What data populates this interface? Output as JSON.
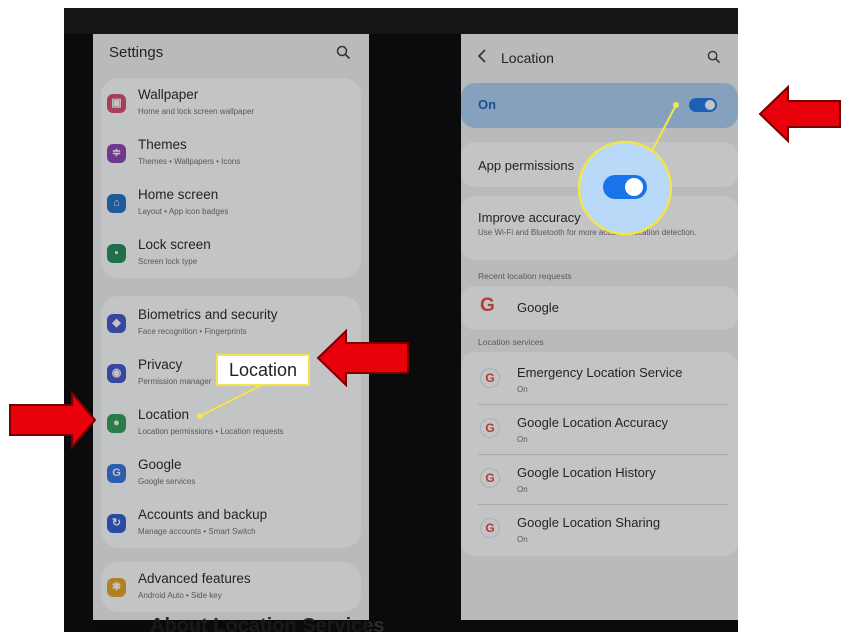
{
  "left_panel": {
    "title": "Settings",
    "items": [
      {
        "title": "Wallpaper",
        "subtitle": "Home and lock screen wallpaper",
        "icon": "wallpaper-icon",
        "color": "#d9466e"
      },
      {
        "title": "Themes",
        "subtitle": "Themes  •  Wallpapers  •  Icons",
        "icon": "themes-icon",
        "color": "#8a3eb0"
      },
      {
        "title": "Home screen",
        "subtitle": "Layout  •  App icon badges",
        "icon": "home-icon",
        "color": "#1a6fc2"
      },
      {
        "title": "Lock screen",
        "subtitle": "Screen lock type",
        "icon": "lock-icon",
        "color": "#1e8a55"
      },
      {
        "title": "Biometrics and security",
        "subtitle": "Face recognition  •  Fingerprints",
        "icon": "shield-icon",
        "color": "#3f53c9"
      },
      {
        "title": "Privacy",
        "subtitle": "Permission manager",
        "icon": "privacy-icon",
        "color": "#3f53c9"
      },
      {
        "title": "Location",
        "subtitle": "Location permissions  •  Location requests",
        "icon": "location-pin-icon",
        "color": "#2e9a55"
      },
      {
        "title": "Google",
        "subtitle": "Google services",
        "icon": "google-icon",
        "color": "#2f6fe0"
      },
      {
        "title": "Accounts and backup",
        "subtitle": "Manage accounts  •  Smart Switch",
        "icon": "sync-icon",
        "color": "#2a58d3"
      },
      {
        "title": "Advanced features",
        "subtitle": "Android Auto  •  Side key",
        "icon": "gear-plus-icon",
        "color": "#e8a21c"
      }
    ],
    "callout_label": "Location"
  },
  "right_panel": {
    "title": "Location",
    "toggle_label": "On",
    "toggle_state": true,
    "app_permissions": "App permissions",
    "improve_accuracy": "Improve accuracy",
    "improve_accuracy_sub": "Use Wi-Fi and Bluetooth for more accurate location detection.",
    "recent_header": "Recent location requests",
    "recent_items": [
      {
        "title": "Google"
      }
    ],
    "services_header": "Location services",
    "services": [
      {
        "title": "Emergency Location Service",
        "subtitle": "On"
      },
      {
        "title": "Google Location Accuracy",
        "subtitle": "On"
      },
      {
        "title": "Google Location History",
        "subtitle": "On"
      },
      {
        "title": "Google Location Sharing",
        "subtitle": "On"
      }
    ]
  },
  "bottom_caption": "About Location Services",
  "colors": {
    "arrow": "#e8000b",
    "callout": "#f3e54a",
    "toggle": "#1a73e8",
    "highlight": "#aad0f5"
  }
}
